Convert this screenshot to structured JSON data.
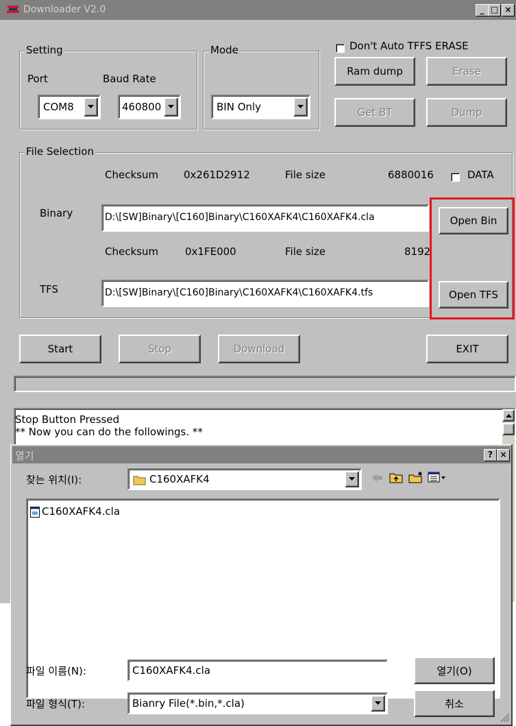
{
  "app": {
    "title": "Downloader V2.0",
    "controls": {
      "minimize": "_",
      "maximize": "□",
      "close": "×"
    }
  },
  "setting": {
    "group_label": "Setting",
    "port_label": "Port",
    "baud_label": "Baud Rate",
    "port_value": "COM8",
    "baud_value": "460800"
  },
  "mode": {
    "group_label": "Mode",
    "value": "BIN Only"
  },
  "options": {
    "dont_auto_tffs_erase": "Don't Auto TFFS ERASE",
    "ram_dump": "Ram dump",
    "erase": "Erase",
    "get_bt": "Get BT",
    "dump": "Dump"
  },
  "file_selection": {
    "group_label": "File Selection",
    "binary": {
      "checksum_label": "Checksum",
      "checksum_value": "0x261D2912",
      "filesize_label": "File size",
      "filesize_value": "6880016",
      "row_label": "Binary",
      "path": "D:\\[SW]Binary\\[C160]Binary\\C160XAFK4\\C160XAFK4.cla",
      "open_button": "Open Bin"
    },
    "data_label": "DATA",
    "tfs": {
      "checksum_label": "Checksum",
      "checksum_value": "0x1FE000",
      "filesize_label": "File size",
      "filesize_value": "8192",
      "row_label": "TFS",
      "path": "D:\\[SW]Binary\\[C160]Binary\\C160XAFK4\\C160XAFK4.tfs",
      "open_button": "Open TFS"
    }
  },
  "actions": {
    "start": "Start",
    "stop": "Stop",
    "download": "Download",
    "exit": "EXIT"
  },
  "log": {
    "line1": "Stop Button Pressed",
    "line2": "** Now you can do the followings. **"
  },
  "open_dialog": {
    "title": "열기",
    "help": "?",
    "close": "×",
    "look_in_label": "찾는 위치(I):",
    "look_in_value": "C160XAFK4",
    "files": [
      "C160XAFK4.cla"
    ],
    "filename_label": "파일 이름(N):",
    "filename_value": "C160XAFK4.cla",
    "filetype_label": "파일 형식(T):",
    "filetype_value": "Bianry File(*.bin,*.cla)",
    "open_button": "열기(O)",
    "cancel_button": "취소"
  },
  "colors": {
    "highlight_box": "#e8141c",
    "window_face": "#c0c0c0",
    "titlebar_inactive": "#808080"
  }
}
